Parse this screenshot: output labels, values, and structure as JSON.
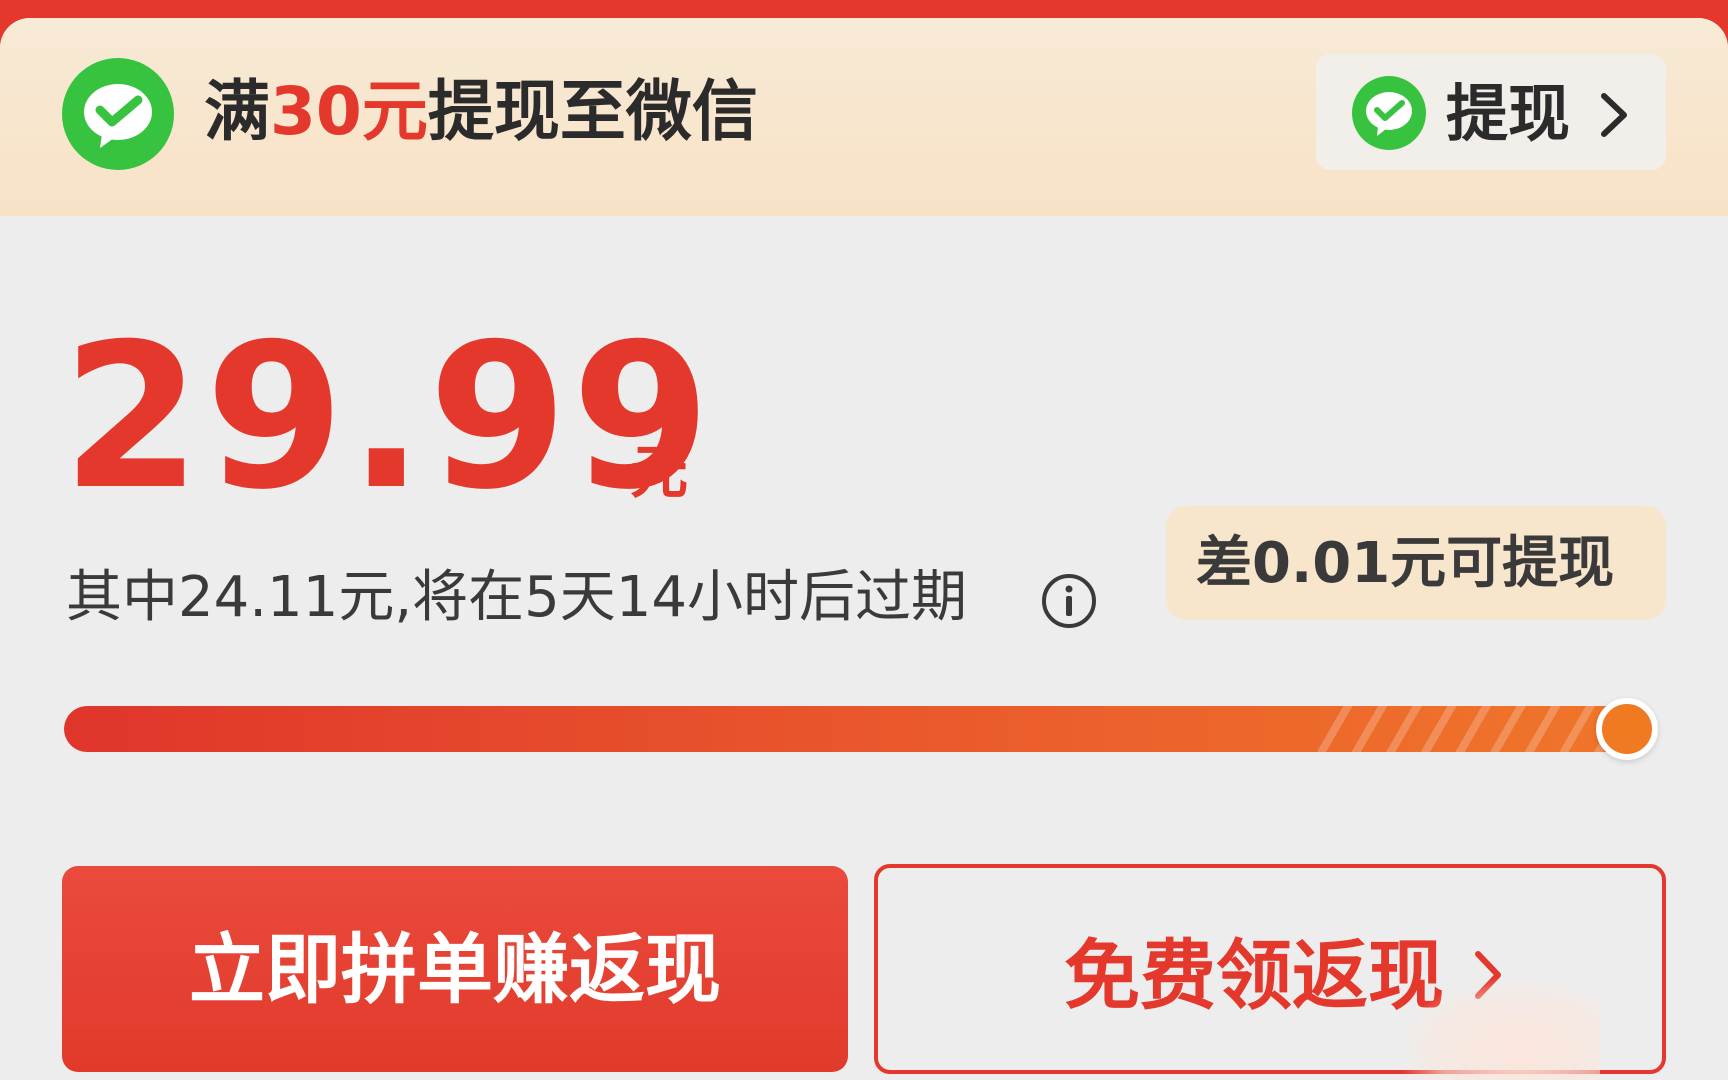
{
  "banner": {
    "prefix": "满",
    "threshold": "30元",
    "suffix": "提现至微信",
    "icon": "wechat-icon",
    "withdraw_button": {
      "label": "提现",
      "icon": "chevron-right-icon"
    }
  },
  "balance": {
    "amount": "29.99",
    "unit": "元",
    "expire_text": "其中24.11元,将在5天14小时后过期",
    "info_icon": "info-icon"
  },
  "diff_badge": {
    "text": "差0.01元可提现"
  },
  "progress": {
    "value": 0.9997
  },
  "actions": {
    "primary_label": "立即拼单赚返现",
    "secondary_label": "免费领返现",
    "secondary_icon": "chevron-right-icon"
  },
  "colors": {
    "brand_red": "#e4382c",
    "wechat_green": "#37c33f",
    "progress_end": "#f07a21",
    "banner_bg": "#f8e2c6"
  }
}
